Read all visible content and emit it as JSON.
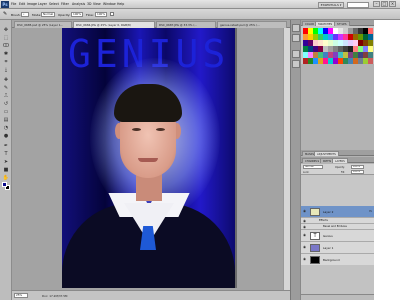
{
  "app": {
    "logo": "Ps"
  },
  "menubar": {
    "items": [
      "File",
      "Edit",
      "Image",
      "Layer",
      "Select",
      "Filter",
      "Analysis",
      "3D",
      "View",
      "Window",
      "Help"
    ],
    "workspace": "ESSENTIALS ▾"
  },
  "options": {
    "brush_label": "Brush:",
    "mode_label": "Mode:",
    "mode_value": "Normal",
    "opacity_label": "Opacity:",
    "opacity_value": "100%",
    "flow_label": "Flow:",
    "flow_value": "100%"
  },
  "tabs": [
    {
      "label": "DSC_0685.psd @ 25% (Layer 1...",
      "active": false
    },
    {
      "label": "DSC_0684.JPG @ 25% (Layer 0, RGB/8)",
      "active": true
    },
    {
      "label": "DSC_0687.JPG @ 33.3% (...",
      "active": false
    },
    {
      "label": "genius-retext.psd @ 25% (...",
      "active": false
    }
  ],
  "canvas": {
    "overlay_text": "GENIUS"
  },
  "status": {
    "zoom": "25%",
    "doc": "Doc: 17.2M/37.5M"
  },
  "panels": {
    "swatches_tabs": [
      "COLOR",
      "SWATCHES",
      "STYLES"
    ],
    "swatch_colors": [
      "#ff0000",
      "#ffff00",
      "#00ff00",
      "#00ffff",
      "#0000ff",
      "#ff00ff",
      "#ffffff",
      "#e6e6e6",
      "#cccccc",
      "#999999",
      "#666666",
      "#333333",
      "#000000",
      "#ff6666",
      "#ff9933",
      "#ffcc00",
      "#99cc00",
      "#33cc66",
      "#00cccc",
      "#3399ff",
      "#6633ff",
      "#cc33ff",
      "#ff3399",
      "#cc0000",
      "#996600",
      "#669900",
      "#006633",
      "#006699",
      "#330099",
      "#660066",
      "#ffcccc",
      "#ffe5cc",
      "#ffffcc",
      "#e5ffcc",
      "#ccffe5",
      "#ccffff",
      "#cce5ff",
      "#e5ccff",
      "#ffccf2",
      "#800000",
      "#804000",
      "#808000",
      "#008040",
      "#004080",
      "#400080",
      "#800040",
      "#c0c0c0",
      "#a0a0a0",
      "#808080",
      "#606060",
      "#404040",
      "#202020",
      "#ff8080",
      "#80ff80",
      "#8080ff",
      "#ffff80",
      "#80ffff",
      "#ff80ff",
      "#c08040",
      "#40c080",
      "#4080c0",
      "#c04080",
      "#8040c0",
      "#40c0c0",
      "#c0c040",
      "#804080",
      "#408040",
      "#404080",
      "#804040",
      "#408080",
      "#b22222",
      "#228b22",
      "#1e90ff",
      "#daa520",
      "#ff1493",
      "#00ced1",
      "#9400d3",
      "#ff4500",
      "#2e8b57",
      "#4682b4",
      "#d2691e",
      "#708090",
      "#9acd32",
      "#cd5c5c"
    ],
    "layer_tabs": [
      "MASKS",
      "ADJUSTMENTS"
    ],
    "layers_tabs": [
      "CHANNELS",
      "PATHS",
      "LAYERS"
    ],
    "blend_mode": "Normal",
    "opacity_label": "Opacity:",
    "opacity_value": "100%",
    "lock_label": "Lock:",
    "fill_label": "Fill:",
    "fill_value": "100%",
    "layers": [
      {
        "name": "Layer 2",
        "selected": true,
        "thumb": "#e8e8b8",
        "fx": "fx"
      },
      {
        "name": "Effects",
        "sub": true
      },
      {
        "name": "Bevel and Emboss",
        "sub": true
      },
      {
        "name": "Genius",
        "thumb": "#ffffff",
        "icon": "T"
      },
      {
        "name": "Layer 1",
        "thumb": "#7a78c8"
      },
      {
        "name": "Background",
        "thumb": "#000000"
      }
    ]
  }
}
